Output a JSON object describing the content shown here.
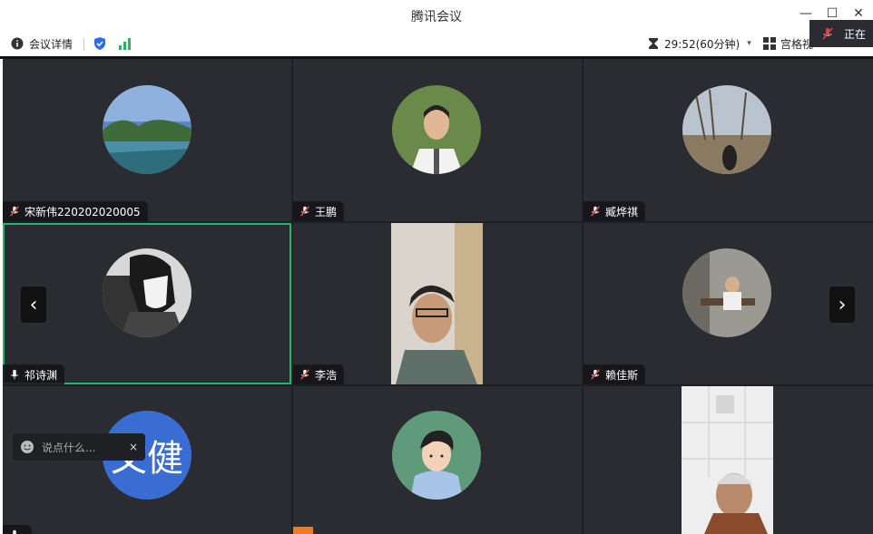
{
  "window": {
    "title": "腾讯会议"
  },
  "toolbar": {
    "meeting_details": "会议详情",
    "timer": "29:52(60分钟)",
    "grid_view": "宫格视"
  },
  "status": {
    "recording_text": "正在"
  },
  "participants": [
    {
      "name": "宋新伟220202020005",
      "muted": true
    },
    {
      "name": "王鹏",
      "muted": true
    },
    {
      "name": "臧烨祺",
      "muted": true
    },
    {
      "name": "祁诗渊",
      "muted": false,
      "active_speaker": true
    },
    {
      "name": "李浩",
      "muted": true
    },
    {
      "name": "赖佳斯",
      "muted": true
    },
    {
      "name": "",
      "avatar_text": "文健",
      "muted": false
    },
    {
      "name": "",
      "muted": true
    },
    {
      "name": "",
      "muted": true
    }
  ],
  "chat": {
    "placeholder": "说点什么..."
  },
  "colors": {
    "active_border": "#1fb964",
    "tile_bg": "#2b2c31",
    "stage_bg": "#1e1f23",
    "avatar_blue": "#3a6dd1"
  },
  "icons": [
    "info-icon",
    "shield-icon",
    "signal-icon",
    "hourglass-icon",
    "grid-icon",
    "mic-muted-icon",
    "mic-icon",
    "chevron-left-icon",
    "chevron-right-icon",
    "emoji-icon"
  ]
}
